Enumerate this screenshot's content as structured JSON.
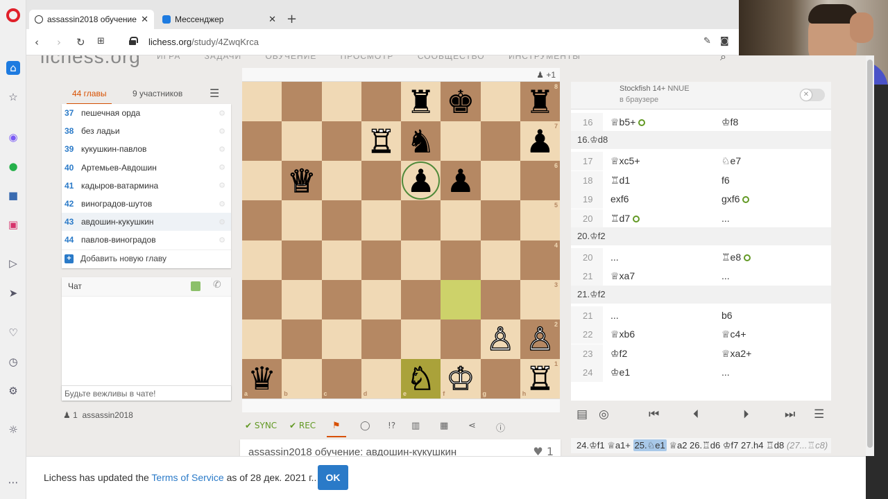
{
  "browser": {
    "tabs": [
      {
        "title": "assassin2018 обучение"
      },
      {
        "title": "Мессенджер"
      }
    ],
    "url_host": "lichess.org",
    "url_path": "/study/4ZwqKrca"
  },
  "site": {
    "logo": "lichess.org",
    "nav": "ИГРА ЗАДАЧИ ОБУЧЕНИЕ ПРОСМОТР СООБЩЕСТВО ИНСТРУМЕНТЫ"
  },
  "study": {
    "tabs": {
      "chapters": "44 главы",
      "members": "9 участников"
    },
    "chapters": [
      {
        "num": "37",
        "name": "пешечная орда"
      },
      {
        "num": "38",
        "name": "без ладьи"
      },
      {
        "num": "39",
        "name": "кукушкин-павлов"
      },
      {
        "num": "40",
        "name": "Артемьев-Авдошин"
      },
      {
        "num": "41",
        "name": "кадыров-ватармина"
      },
      {
        "num": "42",
        "name": "виноградов-шутов"
      },
      {
        "num": "43",
        "name": "авдошин-кукушкин"
      },
      {
        "num": "44",
        "name": "павлов-виноградов"
      }
    ],
    "add_chapter": "Добавить новую главу",
    "chat_label": "Чат",
    "chat_placeholder": "Будьте вежливы в чате!",
    "member_count": "1",
    "member_name": "assassin2018",
    "spectators": "+1",
    "title": "assassin2018 обучение: авдошин-кукушкин",
    "likes": "1"
  },
  "board": {
    "pieces": [
      {
        "sq": "e8",
        "g": "♜",
        "c": "black"
      },
      {
        "sq": "f8",
        "g": "♚",
        "c": "black"
      },
      {
        "sq": "h8",
        "g": "♜",
        "c": "black"
      },
      {
        "sq": "d7",
        "g": "♖",
        "c": "white"
      },
      {
        "sq": "e7",
        "g": "♞",
        "c": "black"
      },
      {
        "sq": "h7",
        "g": "♟",
        "c": "black"
      },
      {
        "sq": "b6",
        "g": "♕",
        "c": "white"
      },
      {
        "sq": "e6",
        "g": "♟",
        "c": "black"
      },
      {
        "sq": "f6",
        "g": "♟",
        "c": "black"
      },
      {
        "sq": "g2",
        "g": "♙",
        "c": "white"
      },
      {
        "sq": "h2",
        "g": "♙",
        "c": "white"
      },
      {
        "sq": "a1",
        "g": "♛",
        "c": "black"
      },
      {
        "sq": "e1",
        "g": "♘",
        "c": "white"
      },
      {
        "sq": "f1",
        "g": "♔",
        "c": "white"
      },
      {
        "sq": "h1",
        "g": "♖",
        "c": "white"
      }
    ],
    "highlights": [
      "f3",
      "e1"
    ],
    "ring": "e6",
    "files": [
      "a",
      "b",
      "c",
      "d",
      "e",
      "f",
      "g",
      "h"
    ],
    "ranks": [
      "8",
      "7",
      "6",
      "5",
      "4",
      "3",
      "2",
      "1"
    ]
  },
  "toolbar": {
    "sync": "SYNC",
    "rec": "REC"
  },
  "engine": {
    "name": "Stockfish 14+",
    "nnue": "NNUE",
    "sub": "в браузере"
  },
  "moves": [
    {
      "type": "row",
      "n": "16",
      "w": "♕b5+",
      "wdot": true,
      "b": "♔f8",
      "bdot": false
    },
    {
      "type": "var",
      "text": "16.♔d8"
    },
    {
      "type": "row",
      "n": "17",
      "w": "♕xc5+",
      "wdot": false,
      "b": "♘e7",
      "bdot": false
    },
    {
      "type": "row",
      "n": "18",
      "w": "♖d1",
      "wdot": false,
      "b": "f6",
      "bdot": false
    },
    {
      "type": "row",
      "n": "19",
      "w": "exf6",
      "wdot": false,
      "b": "gxf6",
      "bdot": true
    },
    {
      "type": "row",
      "n": "20",
      "w": "♖d7",
      "wdot": true,
      "b": "...",
      "bdot": false
    },
    {
      "type": "var",
      "text": "20.♔f2"
    },
    {
      "type": "row",
      "n": "20",
      "w": "...",
      "wdot": false,
      "b": "♖e8",
      "bdot": true
    },
    {
      "type": "row",
      "n": "21",
      "w": "♕xa7",
      "wdot": false,
      "b": "...",
      "bdot": false
    },
    {
      "type": "var",
      "text": "21.♔f2"
    },
    {
      "type": "row",
      "n": "21",
      "w": "...",
      "wdot": false,
      "b": "b6",
      "bdot": false
    },
    {
      "type": "row",
      "n": "22",
      "w": "♕xb6",
      "wdot": false,
      "b": "♕c4+",
      "bdot": false
    },
    {
      "type": "row",
      "n": "23",
      "w": "♔f2",
      "wdot": false,
      "b": "♕xa2+",
      "bdot": false
    },
    {
      "type": "row",
      "n": "24",
      "w": "♔e1",
      "wdot": false,
      "b": "...",
      "bdot": false
    }
  ],
  "mainline": {
    "before": "24.♔f1 ♕a1+",
    "current": "25.♘e1",
    "after": "♕a2 26.♖d6 ♔f7 27.h4 ♖d8",
    "tail": "(27...♖c8)"
  },
  "tos": {
    "prefix": "Lichess has updated the",
    "link": "Terms of Service",
    "suffix": "as of 28 дек. 2021 г..",
    "ok": "OK"
  }
}
